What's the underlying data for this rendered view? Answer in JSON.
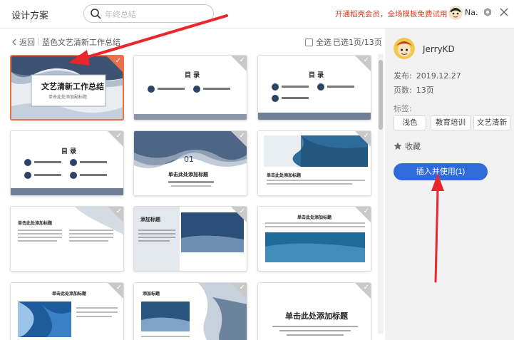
{
  "app": {
    "title": "设计方案"
  },
  "search": {
    "placeholder": "年终总结"
  },
  "promo": {
    "text": "开通稻壳会员，全场模板免费试用"
  },
  "user": {
    "name": "Na."
  },
  "nav": {
    "back_label": "返回",
    "doc_title": "蓝色文艺清新工作总结"
  },
  "selection": {
    "select_all_label": "全选",
    "count_text": "已选1页/13页"
  },
  "slides": [
    {
      "index": 1,
      "selected": true,
      "heading": "文艺清新工作总结",
      "subheading": "单击此处添加副标题"
    },
    {
      "index": 2,
      "selected": false,
      "heading": "目 录"
    },
    {
      "index": 3,
      "selected": false,
      "heading": "目 录"
    },
    {
      "index": 4,
      "selected": false,
      "heading": "目 录"
    },
    {
      "index": 5,
      "selected": false,
      "heading": "单击此处添加标题",
      "number": "01"
    },
    {
      "index": 6,
      "selected": false,
      "heading": "单击此处添加标题"
    },
    {
      "index": 7,
      "selected": false,
      "heading": "单击此处添加标题"
    },
    {
      "index": 8,
      "selected": false,
      "heading": "添加标题"
    },
    {
      "index": 9,
      "selected": false,
      "heading": "单击此处添加标题"
    },
    {
      "index": 10,
      "selected": false,
      "heading": "单击此处添加标题"
    },
    {
      "index": 11,
      "selected": false,
      "heading": "添加标题"
    },
    {
      "index": 12,
      "selected": false,
      "heading": "单击此处添加标题"
    }
  ],
  "toc_item_label": "单击此处添加标题",
  "panel": {
    "author": "JerryKD",
    "publish_label": "发布:",
    "publish_date": "2019.12.27",
    "pages_label": "页数:",
    "pages_value": "13页",
    "tags_label": "标签:",
    "tags": [
      "浅色",
      "教育培训",
      "文艺清新"
    ],
    "favorite_label": "收藏",
    "insert_button": "插入并使用(1)"
  },
  "colors": {
    "accent": "#2f6bd9",
    "selected_border": "#e8734a",
    "promo": "#e5391f",
    "arrow": "#e8262b"
  }
}
